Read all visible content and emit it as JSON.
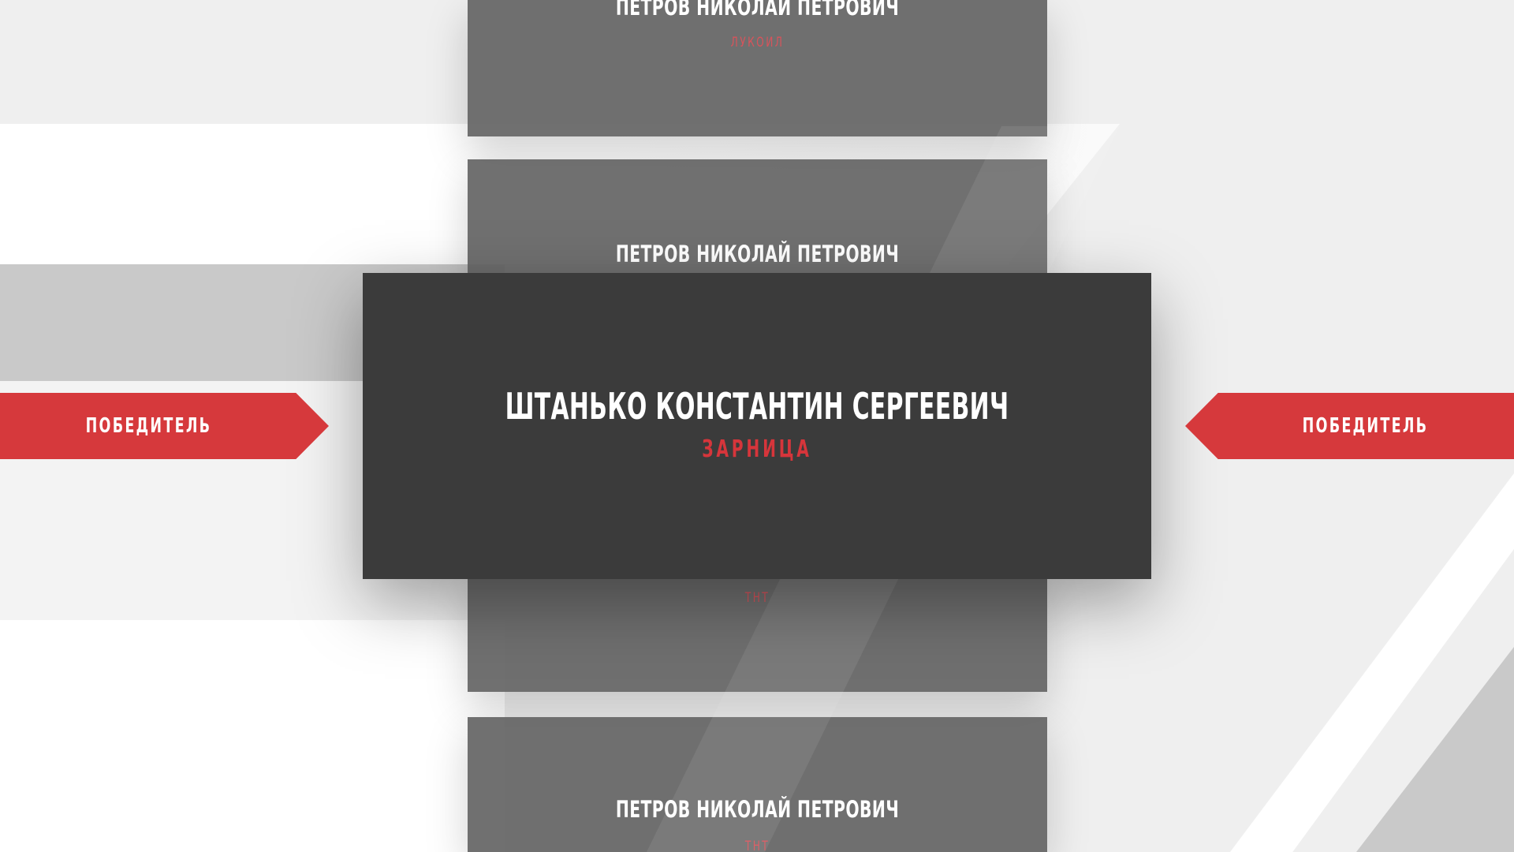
{
  "cards": [
    {
      "name": "ПЕТРОВ НИКОЛАЙ ПЕТРОВИЧ",
      "org": "ЛУКОИЛ"
    },
    {
      "name": "ПЕТРОВ НИКОЛАЙ ПЕТРОВИЧ",
      "org": ""
    },
    {
      "name": "",
      "org": "ТНТ"
    },
    {
      "name": "ПЕТРОВ НИКОЛАЙ ПЕТРОВИЧ",
      "org": "ТНТ"
    }
  ],
  "winner": {
    "name": "ШТАНЬКО КОНСТАНТИН СЕРГЕЕВИЧ",
    "org": "ЗАРНИЦА"
  },
  "ribbons": {
    "left_label": "ПОБЕДИТЕЛЬ",
    "right_label": "ПОБЕДИТЕЛЬ"
  },
  "colors": {
    "accent": "#d6393c",
    "card": "#666666",
    "main_card": "#3b3b3b"
  }
}
